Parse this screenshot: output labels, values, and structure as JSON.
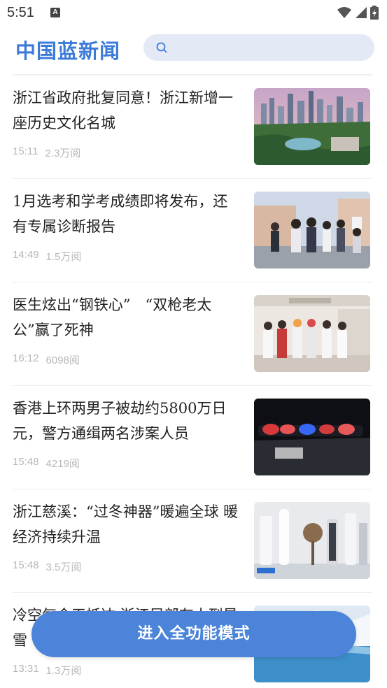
{
  "status_bar": {
    "time": "5:51",
    "notification_badge": "A"
  },
  "app": {
    "logo_text": "中国蓝新闻"
  },
  "search": {
    "placeholder": ""
  },
  "news": [
    {
      "title": "浙江省政府批复同意！浙江新增一座历史文化名城",
      "time": "15:11",
      "views": "2.3万阅"
    },
    {
      "title": "1月选考和学考成绩即将发布，还有专属诊断报告",
      "time": "14:49",
      "views": "1.5万阅"
    },
    {
      "title": "医生炫出“钢铁心”　“双枪老太公”赢了死神",
      "time": "16:12",
      "views": "6098阅"
    },
    {
      "title": "香港上环两男子被劫约5800万日元，警方通缉两名涉案人员",
      "time": "15:48",
      "views": "4219阅"
    },
    {
      "title": "浙江慈溪：“过冬神器”暖遍全球 暖经济持续升温",
      "time": "15:48",
      "views": "3.5万阅"
    },
    {
      "title": "冷空气今天抵达 浙江局部有大到暴雪",
      "time": "13:31",
      "views": "1.3万阅"
    }
  ],
  "cta": {
    "label": "进入全功能模式"
  },
  "colors": {
    "brand": "#3d7bd9",
    "cta": "#4b84d8",
    "search_bg": "#e3eaf6",
    "meta": "#b8b8b8"
  }
}
